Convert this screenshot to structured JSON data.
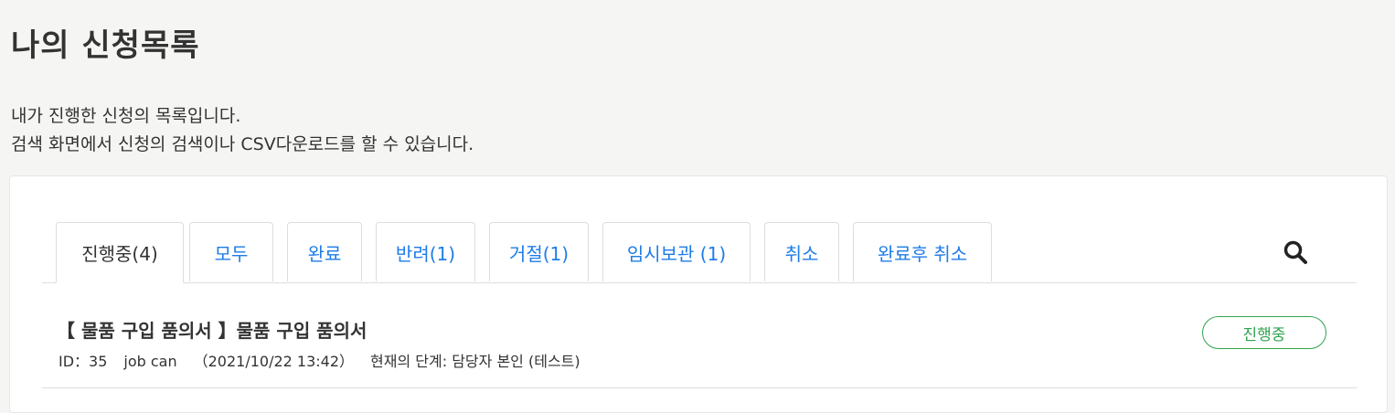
{
  "page": {
    "title": "나의 신청목록",
    "description_line1": "내가 진행한 신청의 목록입니다.",
    "description_line2": "검색 화면에서 신청의 검색이나 CSV다운로드를 할 수 있습니다."
  },
  "tabs": [
    {
      "label": "진행중(4)",
      "active": true
    },
    {
      "label": "모두",
      "active": false
    },
    {
      "label": "완료",
      "active": false
    },
    {
      "label": "반려(1)",
      "active": false
    },
    {
      "label": "거절(1)",
      "active": false
    },
    {
      "label": "임시보관 (1)",
      "active": false
    },
    {
      "label": "취소",
      "active": false
    },
    {
      "label": "완료후 취소",
      "active": false
    }
  ],
  "search": {
    "icon": "search-icon"
  },
  "requests": [
    {
      "title": "【 물품 구입 품의서 】물품 구입 품의서",
      "id_text": "ID：35",
      "applicant": "job can",
      "datetime": "（2021/10/22 13:42）",
      "stage": "현재의 단계: 담당자 본인 (테스트)",
      "status": "진행중"
    }
  ],
  "colors": {
    "link": "#1e7ce8",
    "status_in_progress": "#2ea44f",
    "background": "#f5f5f3"
  }
}
